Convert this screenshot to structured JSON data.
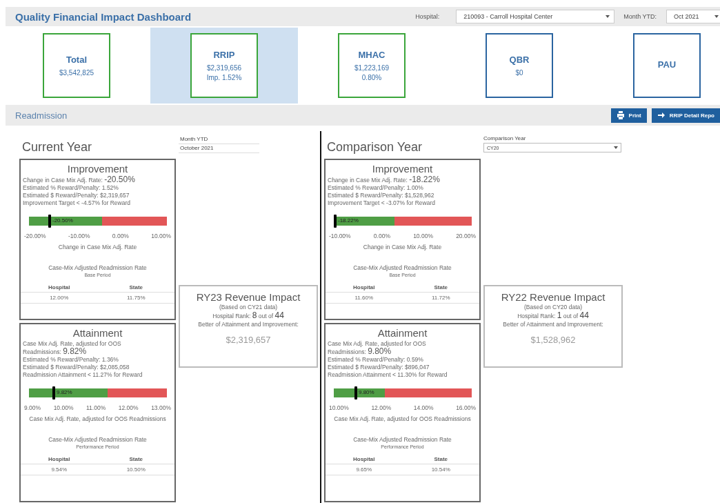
{
  "header": {
    "title": "Quality Financial Impact Dashboard",
    "filters": [
      {
        "label": "Hospital:",
        "value": "210093 - Carroll Hospital Center"
      },
      {
        "label": "Month YTD:",
        "value": "Oct 2021"
      }
    ]
  },
  "kpis": [
    {
      "name": "Total",
      "lines": [
        "$3,542,825"
      ],
      "color": "#3aa53a",
      "selected": false
    },
    {
      "name": "RRIP",
      "lines": [
        "$2,319,656",
        "Imp. 1.52%"
      ],
      "color": "#3aa53a",
      "selected": true
    },
    {
      "name": "MHAC",
      "lines": [
        "$1,223,169",
        "0.80%"
      ],
      "color": "#3aa53a",
      "selected": false
    },
    {
      "name": "QBR",
      "lines": [
        "$0"
      ],
      "color": "#2a64a0",
      "selected": false
    },
    {
      "name": "PAU",
      "color": "#2a64a0",
      "selected": false
    }
  ],
  "section": {
    "title": "Readmission",
    "buttons": [
      {
        "kind": "print",
        "label": "Print"
      },
      {
        "kind": "detail",
        "label": "RRIP Detail Repo"
      }
    ]
  },
  "panels": [
    {
      "heading": "Current Year",
      "control": {
        "kind": "text",
        "label": "Month YTD",
        "value": "October 2021"
      },
      "improvement": {
        "title": "Improvement",
        "metrics": [
          {
            "label": "Change in Case Mix Adj. Rate:",
            "value": "-20.50%"
          },
          {
            "label": "Estimated % Reward/Penalty: 1.52%"
          },
          {
            "label": "Estimated $ Reward/Penalty: $2,319,657"
          },
          {
            "label": "Improvement Target < -4.57% for Reward"
          }
        ],
        "gauge": {
          "level": 0.15,
          "reading": "-20.50%",
          "segments": [
            {
              "kind": "reward",
              "level": 0.53
            },
            {
              "kind": "penalty",
              "level": 0.47
            }
          ],
          "ticks": [
            "-20.00%",
            "-10.00%",
            "0.00%",
            "10.00%"
          ],
          "axis_title": "Change in Case Mix Adj. Rate"
        },
        "table": {
          "title": "Case-Mix Adjusted Readmission Rate",
          "subtitle": "Base Period",
          "columns": [
            "Hospital",
            "State"
          ],
          "values": [
            "12.00%",
            "11.75%"
          ]
        }
      },
      "attainment": {
        "title": "Attainment",
        "metrics": [
          {
            "label": "Case Mix Adj. Rate, adjusted for OOS Readmissions:",
            "value": "9.82%"
          },
          {
            "label": "Estimated % Reward/Penalty: 1.36%"
          },
          {
            "label": "Estimated $ Reward/Penalty: $2,085,058"
          },
          {
            "label": "Readmission Attainment < 11.27% for Reward"
          }
        ],
        "gauge": {
          "level": 0.18,
          "reading": "9.82%",
          "segments": [
            {
              "kind": "reward",
              "level": 0.57
            },
            {
              "kind": "penalty",
              "level": 0.43
            }
          ],
          "ticks": [
            "9.00%",
            "10.00%",
            "11.00%",
            "12.00%",
            "13.00%"
          ],
          "axis_title": "Case Mix Adj. Rate, adjusted for OOS Readmissions"
        },
        "table": {
          "title": "Case-Mix Adjusted Readmission Rate",
          "subtitle": "Performance Period",
          "columns": [
            "Hospital",
            "State"
          ],
          "values": [
            "9.54%",
            "10.50%"
          ]
        }
      },
      "revenue": {
        "title": "RY23 Revenue Impact",
        "basis": "(Based on  CY21 data)",
        "rank": "Hospital Rank: **8** out of **44**",
        "note": "Better of Attainment and Improvement:",
        "value": "$2,319,657"
      }
    },
    {
      "heading": "Comparison Year",
      "control": {
        "kind": "select",
        "label": "Comparison Year",
        "value": "CY20"
      },
      "improvement": {
        "title": "Improvement",
        "metrics": [
          {
            "label": "Change in Case Mix Adj. Rate:",
            "value": "-18.22%"
          },
          {
            "label": "Estimated % Reward/Penalty: 1.00%"
          },
          {
            "label": "Estimated $ Reward/Penalty: $1,528,962"
          },
          {
            "label": "Improvement Target < -3.07% for Reward"
          }
        ],
        "gauge": {
          "level": 0.01,
          "reading": "-18.22%",
          "segments": [
            {
              "kind": "reward",
              "level": 0.44
            },
            {
              "kind": "penalty",
              "level": 0.56
            }
          ],
          "ticks": [
            "-10.00%",
            "0.00%",
            "10.00%",
            "20.00%"
          ],
          "axis_title": "Change in Case Mix Adj. Rate"
        },
        "table": {
          "title": "Case-Mix Adjusted Readmission Rate",
          "subtitle": "Base Period",
          "columns": [
            "Hospital",
            "State"
          ],
          "values": [
            "11.60%",
            "11.72%"
          ]
        }
      },
      "attainment": {
        "title": "Attainment",
        "metrics": [
          {
            "label": "Case Mix Adj. Rate, adjusted for OOS Readmissions:",
            "value": "9.80%"
          },
          {
            "label": "Estimated % Reward/Penalty: 0.59%"
          },
          {
            "label": "Estimated $ Reward/Penalty: $896,047"
          },
          {
            "label": "Readmission Attainment < 11.30% for Reward"
          }
        ],
        "gauge": {
          "level": 0.16,
          "reading": "9.80%",
          "segments": [
            {
              "kind": "reward",
              "level": 0.37
            },
            {
              "kind": "penalty",
              "level": 0.63
            }
          ],
          "ticks": [
            "10.00%",
            "12.00%",
            "14.00%",
            "16.00%"
          ],
          "axis_title": "Case Mix Adj. Rate, adjusted for OOS Readmissions"
        },
        "table": {
          "title": "Case-Mix Adjusted Readmission Rate",
          "subtitle": "Performance Period",
          "columns": [
            "Hospital",
            "State"
          ],
          "values": [
            "9.65%",
            "10.54%"
          ]
        }
      },
      "revenue": {
        "title": "RY22 Revenue Impact",
        "basis": "(Based on  CY20 data)",
        "rank": "Hospital Rank: **1** out of **44**",
        "note": "Better of Attainment and Improvement:",
        "value": "$1,528,962"
      }
    }
  ]
}
